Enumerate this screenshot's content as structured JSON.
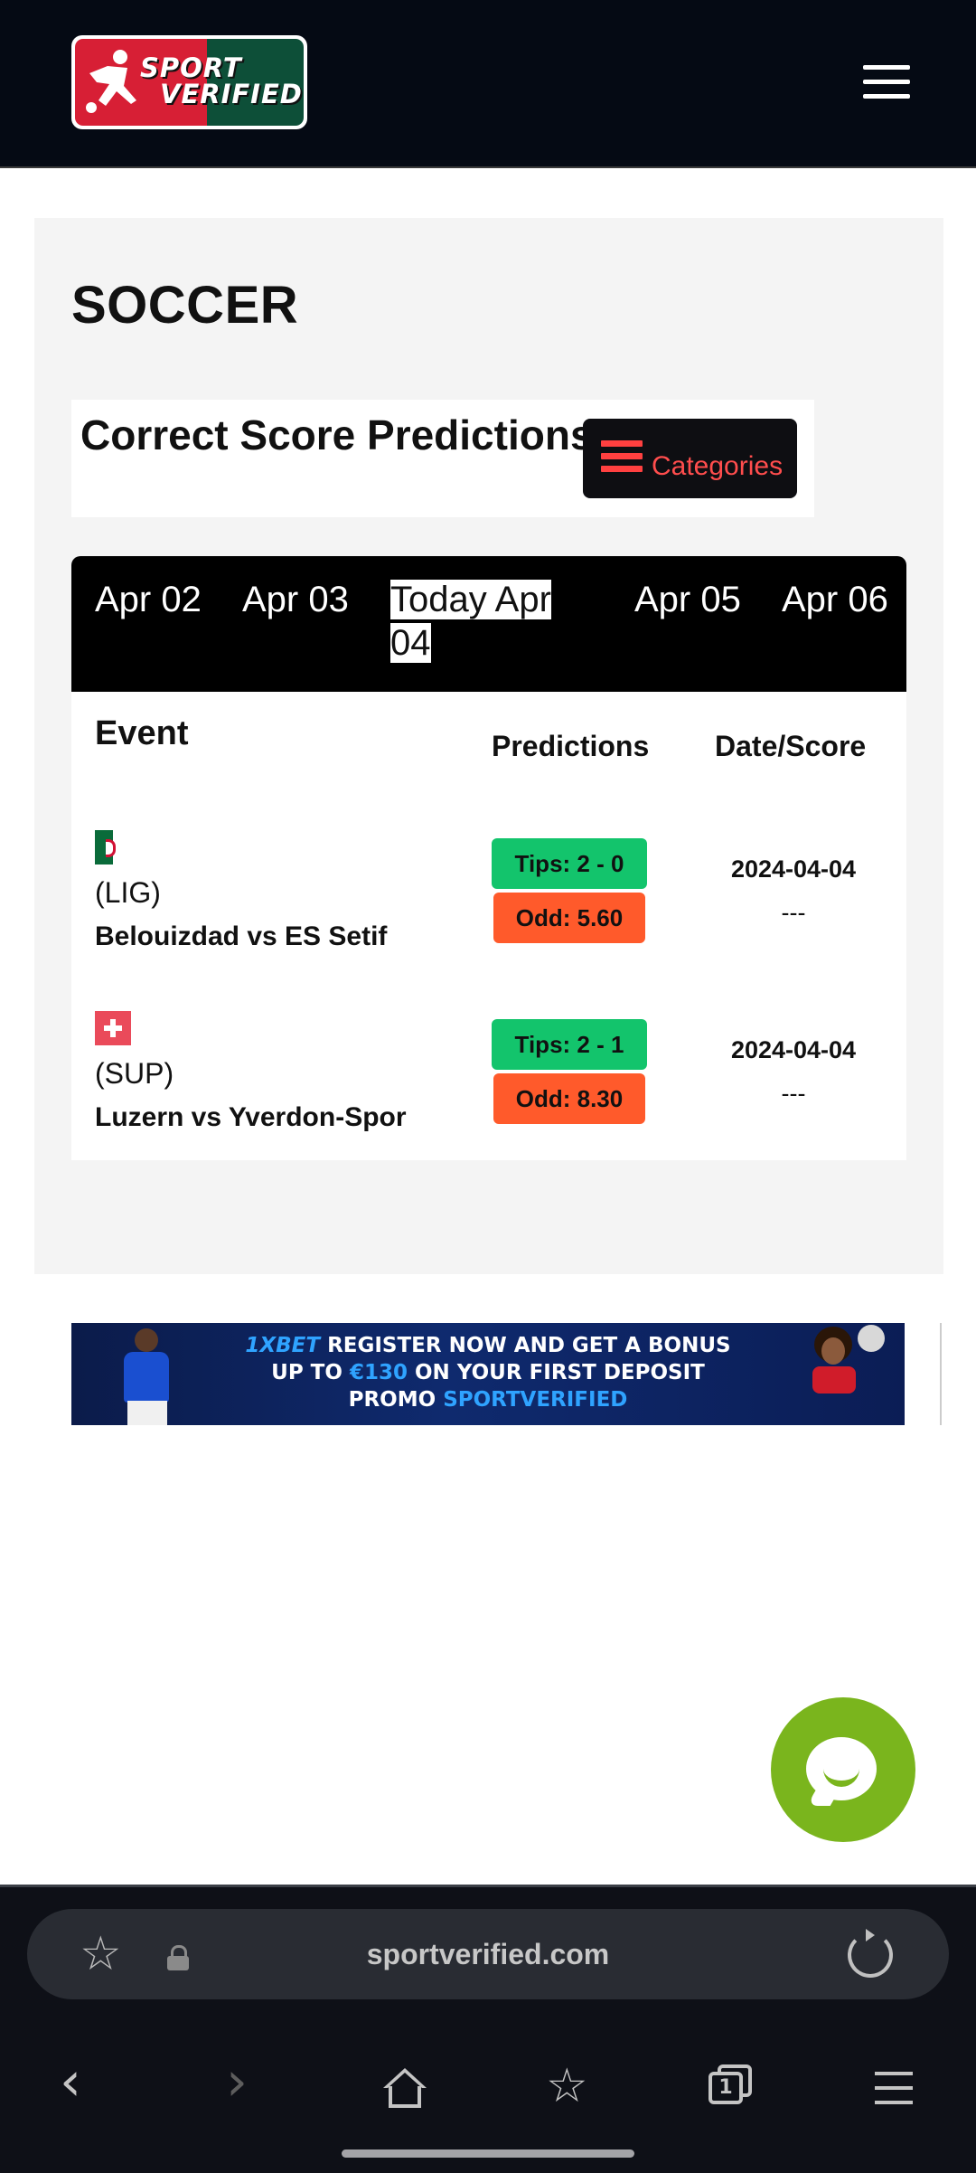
{
  "header": {
    "logo_line1": "SPORT",
    "logo_line2": "VERIFIED",
    "menu_icon": "hamburger-icon"
  },
  "page": {
    "title": "SOCCER",
    "subtitle": "Correct Score Predictions",
    "categories_label": "Categories"
  },
  "date_tabs": [
    {
      "label": "Apr 02"
    },
    {
      "label": "Apr 03"
    },
    {
      "label": "Today Apr 04",
      "active": true
    },
    {
      "label": "Apr 05"
    },
    {
      "label": "Apr 06"
    }
  ],
  "table": {
    "headers": {
      "event": "Event",
      "predictions": "Predictions",
      "date_score": "Date/Score"
    },
    "rows": [
      {
        "flag": "algeria-flag-icon",
        "league": "(LIG)",
        "match": "Belouizdad vs ES Setif",
        "tip": "Tips: 2 - 0",
        "odd": "Odd: 5.60",
        "date": "2024-04-04",
        "score": "---"
      },
      {
        "flag": "switzerland-flag-icon",
        "league": "(SUP)",
        "match": "Luzern vs Yverdon-Spor",
        "tip": "Tips: 2 - 1",
        "odd": "Odd: 8.30",
        "date": "2024-04-04",
        "score": "---"
      }
    ]
  },
  "banner": {
    "brand": "1XBET",
    "line1": "REGISTER NOW AND GET A BONUS",
    "line2_pre": "UP TO",
    "line2_amount": "€130",
    "line2_post": "ON YOUR FIRST DEPOSIT",
    "line3_pre": "PROMO",
    "line3_code": "SPORTVERIFIED"
  },
  "chat_button": {
    "icon": "chat-bubble-icon",
    "color": "#7ab51d"
  },
  "browser": {
    "url": "sportverified.com",
    "tab_count": "1"
  },
  "colors": {
    "header_bg": "#050a14",
    "tip_green": "#13c46c",
    "odd_orange": "#ff5a2b",
    "categories_red": "#ff4d4d"
  }
}
